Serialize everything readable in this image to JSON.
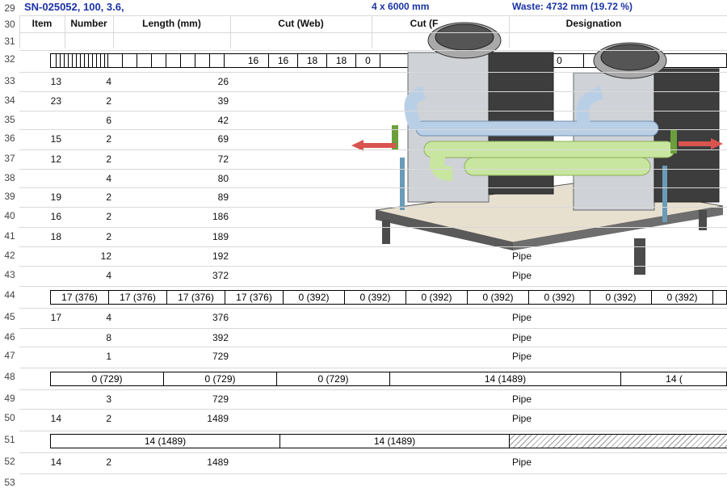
{
  "title": {
    "text": "SN-025052, 100, 3.6,",
    "qty": "4 x 6000 mm",
    "waste": "Waste: 4732 mm (19.72 %)"
  },
  "row_numbers": [
    "29",
    "30",
    "31",
    "32",
    "33",
    "34",
    "35",
    "36",
    "37",
    "38",
    "39",
    "40",
    "41",
    "42",
    "43",
    "44",
    "45",
    "46",
    "47",
    "48",
    "49",
    "50",
    "51",
    "52",
    "53"
  ],
  "headers": {
    "item": "Item",
    "number": "Number",
    "length": "Length (mm)",
    "cut_web": "Cut (Web)",
    "cut_f": "Cut (F",
    "designation": "Designation"
  },
  "bar32_labels": [
    "16",
    "16",
    "18",
    "18",
    "0",
    "0",
    "0"
  ],
  "rows": [
    {
      "row": "33",
      "item": "13",
      "number": "4",
      "length": "26",
      "designation": ""
    },
    {
      "row": "34",
      "item": "23",
      "number": "2",
      "length": "39",
      "designation": ""
    },
    {
      "row": "35",
      "item": "",
      "number": "6",
      "length": "42",
      "designation": ""
    },
    {
      "row": "36",
      "item": "15",
      "number": "2",
      "length": "69",
      "designation": ""
    },
    {
      "row": "37",
      "item": "12",
      "number": "2",
      "length": "72",
      "designation": ""
    },
    {
      "row": "38",
      "item": "",
      "number": "4",
      "length": "80",
      "designation": ""
    },
    {
      "row": "39",
      "item": "19",
      "number": "2",
      "length": "89",
      "designation": ""
    },
    {
      "row": "40",
      "item": "16",
      "number": "2",
      "length": "186",
      "designation": ""
    },
    {
      "row": "41",
      "item": "18",
      "number": "2",
      "length": "189",
      "designation": ""
    },
    {
      "row": "42",
      "item": "",
      "number": "12",
      "length": "192",
      "designation": "Pipe"
    },
    {
      "row": "43",
      "item": "",
      "number": "4",
      "length": "372",
      "designation": "Pipe"
    }
  ],
  "bar44_labels": [
    "17 (376)",
    "17 (376)",
    "17 (376)",
    "17 (376)",
    "0 (392)",
    "0 (392)",
    "0 (392)",
    "0 (392)",
    "0 (392)",
    "0 (392)",
    "0 (392)"
  ],
  "rows2": [
    {
      "row": "45",
      "item": "17",
      "number": "4",
      "length": "376",
      "designation": "Pipe"
    },
    {
      "row": "46",
      "item": "",
      "number": "8",
      "length": "392",
      "designation": "Pipe"
    },
    {
      "row": "47",
      "item": "",
      "number": "1",
      "length": "729",
      "designation": "Pipe"
    }
  ],
  "bar48_labels": [
    "0 (729)",
    "0 (729)",
    "0 (729)",
    "14 (1489)",
    "14 ("
  ],
  "rows3": [
    {
      "row": "49",
      "item": "",
      "number": "3",
      "length": "729",
      "designation": "Pipe"
    },
    {
      "row": "50",
      "item": "14",
      "number": "2",
      "length": "1489",
      "designation": "Pipe"
    }
  ],
  "bar51_labels": [
    "14 (1489)",
    "14 (1489)"
  ],
  "rows4": [
    {
      "row": "52",
      "item": "14",
      "number": "2",
      "length": "1489",
      "designation": "Pipe"
    }
  ],
  "colors": {
    "title": "#1a33a6",
    "grid": "#d9d9d9",
    "pipe_blue": "#b9cfe6",
    "pipe_green": "#c9e6a0",
    "steel": "#8d8d8d"
  }
}
